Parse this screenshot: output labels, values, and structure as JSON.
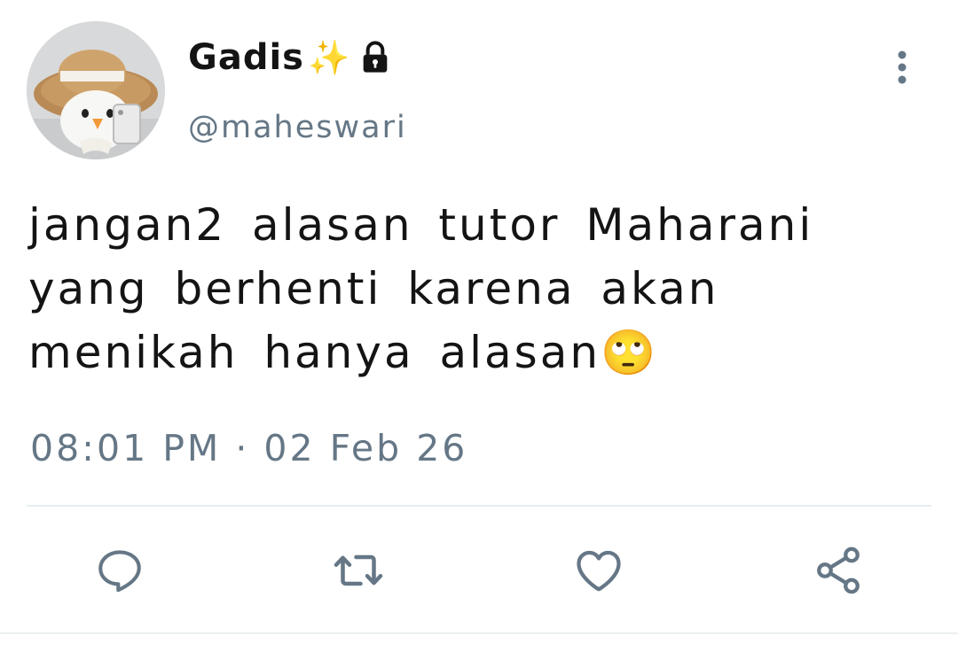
{
  "user": {
    "display_name": "Gadis",
    "name_emoji": "✨",
    "handle": "@maheswari",
    "protected_icon": "lock-icon",
    "avatar_icon": "avatar-photo"
  },
  "tweet": {
    "text": "jangan2 alasan tutor Maharani yang berhenti karena akan menikah hanya alasan🙄",
    "timestamp": "08:01 PM · 02 Feb 26"
  },
  "actions": [
    {
      "name": "reply",
      "icon": "reply-icon"
    },
    {
      "name": "retweet",
      "icon": "retweet-icon"
    },
    {
      "name": "like",
      "icon": "heart-icon"
    },
    {
      "name": "share",
      "icon": "share-icon"
    }
  ],
  "colors": {
    "text_primary": "#141414",
    "text_secondary": "#657786",
    "icon": "#657786",
    "divider": "#e6ecf0"
  }
}
